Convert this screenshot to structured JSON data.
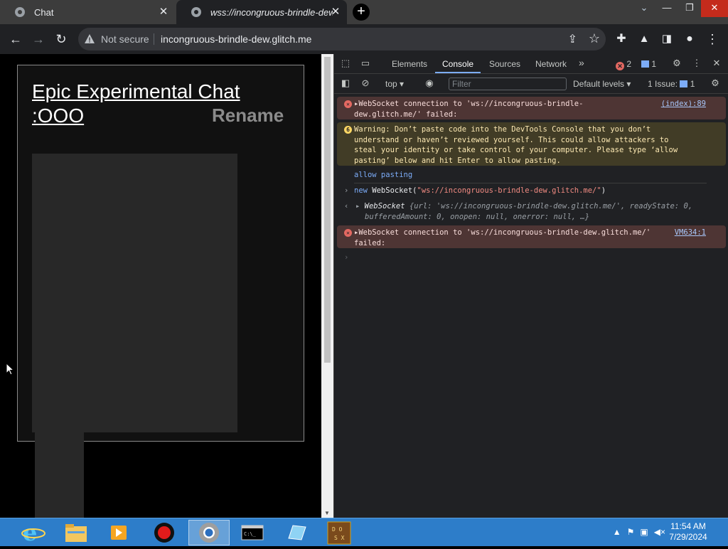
{
  "browser": {
    "tabs": [
      {
        "title": "Chat"
      },
      {
        "title": "wss://incongruous-brindle-dew.glitch.me/"
      }
    ],
    "security_label": "Not secure",
    "url": "incongruous-brindle-dew.glitch.me"
  },
  "page": {
    "title": "Epic Experimental Chat :OOO",
    "rename_label": "Rename"
  },
  "devtools": {
    "tabs": [
      "Elements",
      "Console",
      "Sources",
      "Network"
    ],
    "active_tab": "Console",
    "error_count": "2",
    "issue_badge_count": "1",
    "context": "top",
    "filter_placeholder": "Filter",
    "levels": "Default levels",
    "issues_label": "1 Issue:",
    "issues_count": "1",
    "console": {
      "err1_line1": "WebSocket connection to 'ws://incongruous-brindle-",
      "err1_line2": "dew.glitch.me/' failed:",
      "err1_src": "(index):89",
      "warn_count": "6",
      "warn_l1": "Warning: Don’t paste code into the DevTools Console that you don’t",
      "warn_l2": "understand or haven’t reviewed yourself. This could allow attackers to",
      "warn_l3": "steal your identity or take control of your computer. Please type ‘allow",
      "warn_l4": "pasting’ below and hit Enter to allow pasting.",
      "allow_pasting": "allow pasting",
      "cmd_keyword": "new",
      "cmd_fn": " WebSocket(",
      "cmd_str": "\"ws://incongruous-brindle-dew.glitch.me/\"",
      "cmd_close": ")",
      "result_type": "WebSocket",
      "result_l1_rest": " {url: 'ws://incongruous-brindle-dew.glitch.me/', readyState: 0,",
      "result_l2": "bufferedAmount: 0, onopen: null, onerror: null, …}",
      "err2_line1": "WebSocket connection to 'ws://incongruous-brindle-dew.glitch.me/'",
      "err2_line2": "failed:",
      "err2_src": "VM634:1"
    }
  },
  "taskbar": {
    "time": "11:54 AM",
    "date": "7/29/2024",
    "apps": [
      "internet-explorer",
      "file-explorer",
      "media-player",
      "record",
      "chrome",
      "command-prompt",
      "notepad-app",
      "dosbox"
    ]
  },
  "colors": {
    "console_error_bg": "#4e3534",
    "console_warning_bg": "#413c26",
    "taskbar": "#2d7dc9"
  }
}
